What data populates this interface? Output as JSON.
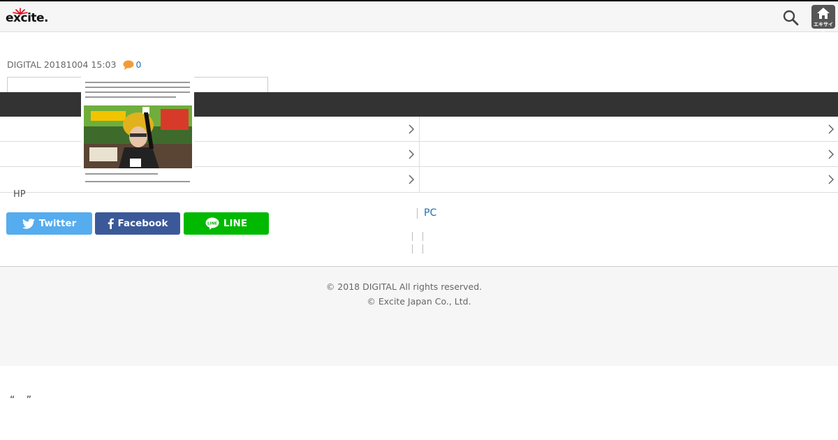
{
  "header": {
    "logo_text": "excite.",
    "home_label": "エキサイト",
    "accent_color": "#e60012"
  },
  "article": {
    "meta": "DIGITAL 20181004 15:03",
    "comment_count": "0"
  },
  "page": {
    "hp_label": "HP",
    "pc_label": "PC"
  },
  "share": {
    "twitter_label": "Twitter",
    "facebook_label": "Facebook",
    "line_label": "LINE",
    "twitter_color": "#55acee",
    "facebook_color": "#3b5998",
    "line_color": "#00b900"
  },
  "footer": {
    "copyright1": "© 2018 DIGITAL All rights reserved.",
    "copyright2": "© Excite Japan Co., Ltd."
  },
  "quote": "“ ”",
  "icons": {
    "search": "search-icon",
    "home": "home-icon",
    "comment": "comment-icon",
    "chevron": "chevron-right-icon"
  }
}
